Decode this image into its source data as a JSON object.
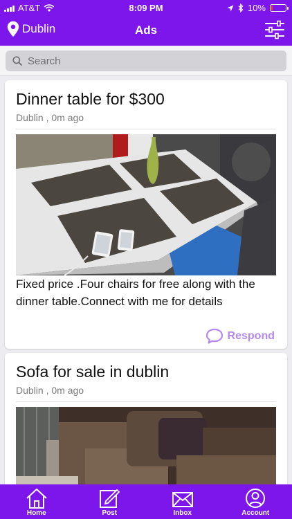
{
  "status_bar": {
    "carrier": "AT&T",
    "time": "8:09 PM",
    "battery_text": "10%",
    "battery_level": 0.1
  },
  "nav": {
    "location": "Dublin",
    "title": "Ads"
  },
  "search": {
    "placeholder": "Search"
  },
  "ads": [
    {
      "title": "Dinner table for $300",
      "meta": "Dublin , 0m ago",
      "description": "Fixed price .Four chairs for free along with the dinner table.Connect with me for details",
      "respond_label": "Respond"
    },
    {
      "title": "Sofa for sale in dublin",
      "meta": "Dublin , 0m ago"
    }
  ],
  "tabs": [
    {
      "label": "Home",
      "icon": "home-icon"
    },
    {
      "label": "Post",
      "icon": "post-icon"
    },
    {
      "label": "Inbox",
      "icon": "inbox-icon"
    },
    {
      "label": "Account",
      "icon": "account-icon"
    }
  ],
  "colors": {
    "brand": "#7c16ea",
    "respond": "#b58af0",
    "battery_low": "#ff3b30"
  }
}
